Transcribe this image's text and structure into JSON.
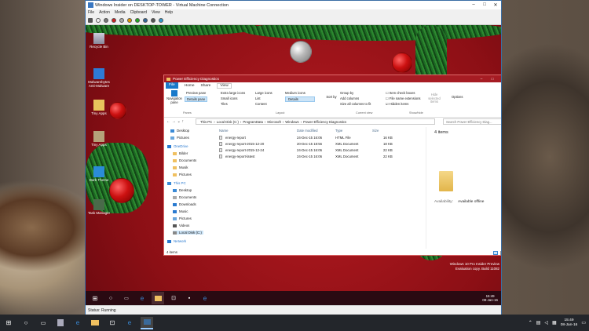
{
  "vm": {
    "title": "Windows Insider on DESKTOP-TOWER - Virtual Machine Connection",
    "menu": [
      "File",
      "Action",
      "Media",
      "Clipboard",
      "View",
      "Help"
    ],
    "status": "Status: Running"
  },
  "desktop": {
    "icons": [
      "Recycle Bin",
      "Malwarebytes Anti-Malware",
      "Tiny Apps",
      "Tiny Apps",
      "Dark Theme",
      "Task Manager"
    ]
  },
  "explorer": {
    "title": "Power Efficiency Diagnostics",
    "tabs": [
      "File",
      "Home",
      "Share",
      "View"
    ],
    "ribbon": {
      "nav_pane": "Navigation pane",
      "preview_pane": "Preview pane",
      "details_pane": "Details pane",
      "extra_large": "Extra large icons",
      "large": "Large icons",
      "medium": "Medium icons",
      "small": "Small icons",
      "list": "List",
      "details": "Details",
      "tiles": "Tiles",
      "content": "Content",
      "sort_by": "Sort by",
      "group_by": "Group by",
      "add_columns": "Add columns",
      "size_all": "Size all columns to fit",
      "item_check": "Item check boxes",
      "file_ext": "File name extensions",
      "hidden_items": "Hidden items",
      "hide_selected": "Hide selected items",
      "options": "Options",
      "groups": [
        "Panes",
        "Layout",
        "Current view",
        "Show/hide"
      ]
    },
    "breadcrumb": [
      "This PC",
      "Local Disk (C:)",
      "ProgramData",
      "Microsoft",
      "Windows",
      "Power Efficiency Diagnostics"
    ],
    "search_placeholder": "Search Power Efficiency Diag...",
    "nav": [
      {
        "label": "Desktop"
      },
      {
        "label": "Pictures"
      },
      {
        "label": "OneDrive"
      },
      {
        "label": "Bilder"
      },
      {
        "label": "Documents"
      },
      {
        "label": "Musik"
      },
      {
        "label": "Pictures"
      },
      {
        "label": "This PC"
      },
      {
        "label": "Desktop"
      },
      {
        "label": "Documents"
      },
      {
        "label": "Downloads"
      },
      {
        "label": "Music"
      },
      {
        "label": "Pictures"
      },
      {
        "label": "Videos"
      },
      {
        "label": "Local Disk (C:)"
      },
      {
        "label": "Network"
      }
    ],
    "columns": [
      "Name",
      "Date modified",
      "Type",
      "Size"
    ],
    "files": [
      {
        "name": "energy-report",
        "date": "24-Dec-15 16:06",
        "type": "HTML File",
        "size": "16 KB"
      },
      {
        "name": "energy-report-2015-12-20",
        "date": "20-Dec-15 18:56",
        "type": "XML Document",
        "size": "18 KB"
      },
      {
        "name": "energy-report-2015-12-24",
        "date": "24-Dec-15 16:06",
        "type": "XML Document",
        "size": "22 KB"
      },
      {
        "name": "energy-report-latest",
        "date": "24-Dec-15 16:06",
        "type": "XML Document",
        "size": "22 KB"
      }
    ],
    "preview": {
      "title": "4 items",
      "availability_label": "Availability:",
      "availability_value": "Available offline"
    },
    "status": "4 items"
  },
  "guest_watermark": [
    "Windows 10 Pro Insider Preview",
    "Evaluation copy. Build 11082"
  ],
  "guest_clock": {
    "time": "15:49",
    "date": "08-Jan-16"
  },
  "host_clock": {
    "time": "15:49",
    "date": "08-Jan-16"
  },
  "colors": {
    "accent": "#1979ca",
    "explorer_title": "#a61c23",
    "guest_bg": "#9a1218"
  }
}
